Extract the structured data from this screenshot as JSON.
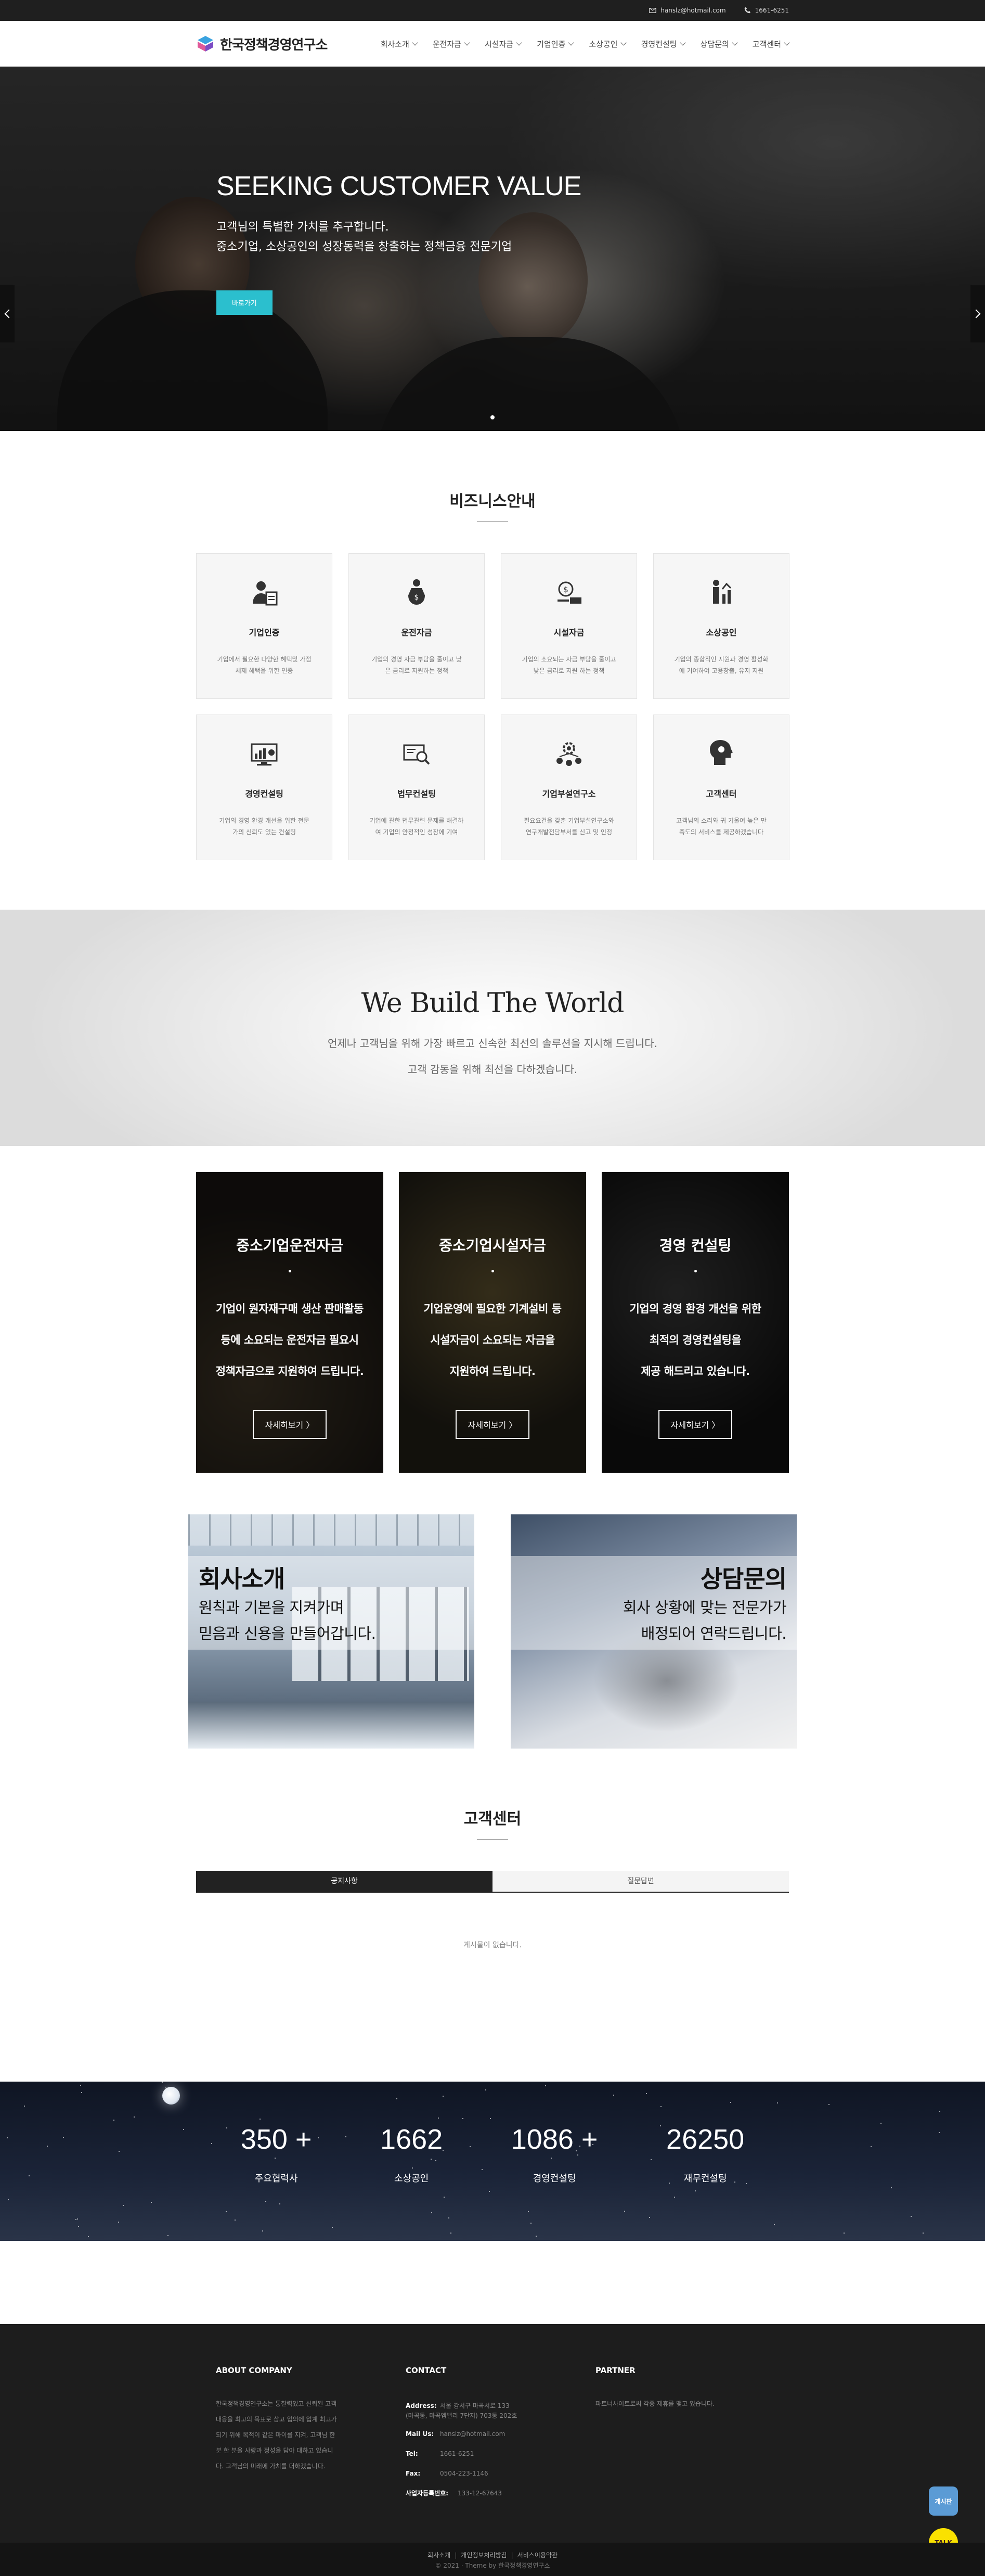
{
  "topbar": {
    "email": "hanslz@hotmail.com",
    "phone": "1661-6251"
  },
  "logo": {
    "text": "한국정책경영연구소"
  },
  "nav": [
    {
      "label": "회사소개"
    },
    {
      "label": "운전자금"
    },
    {
      "label": "시설자금"
    },
    {
      "label": "기업인증"
    },
    {
      "label": "소상공인"
    },
    {
      "label": "경영컨설팅"
    },
    {
      "label": "상담문의"
    },
    {
      "label": "고객센터"
    }
  ],
  "hero": {
    "title": "SEEKING CUSTOMER VALUE",
    "line1": "고객님의 특별한 가치를 추구합니다.",
    "line2": "중소기업, 소상공인의 성장동력을 창출하는 정책금융 전문기업",
    "button": "바로가기"
  },
  "business": {
    "title": "비즈니스안내",
    "cards": [
      {
        "title": "기업인증",
        "desc1": "기업에서 필요한 다양한 혜택및 가점",
        "desc2": "세제 혜택을 위한 인증",
        "icon": "person-certificate-icon"
      },
      {
        "title": "운전자금",
        "desc1": "기업의 경영 자금 부담을 줄이고 낮",
        "desc2": "은 금리로 지원하는 정책",
        "icon": "money-bag-icon"
      },
      {
        "title": "시설자금",
        "desc1": "기업의 소요되는 자금 부담을 줄이고",
        "desc2": "낮은 금리로 지원 하는 정책",
        "icon": "coin-hand-icon"
      },
      {
        "title": "소상공인",
        "desc1": "기업의 종합적인 지원과 경영 활성화",
        "desc2": "에 기여하여 고용창출, 유지 지원",
        "icon": "people-growth-icon"
      },
      {
        "title": "경영컨설팅",
        "desc1": "기업의 경영 환경 개선을 위한 전문",
        "desc2": "가의 신뢰도 있는 컨설팅",
        "icon": "monitor-chart-icon"
      },
      {
        "title": "법무컨설팅",
        "desc1": "기업에 관한 법무관련 문제를 해결하",
        "desc2": "여 기업의 안정적인 성장에 기여",
        "icon": "document-search-icon"
      },
      {
        "title": "기업부설연구소",
        "desc1": "필요요건을 갖춘 기업부설연구소와",
        "desc2": "연구개발전담부서를 신고 및 인정",
        "icon": "gear-team-icon"
      },
      {
        "title": "고객센터",
        "desc1": "고객님의 소리와 귀 기울여 높은 만",
        "desc2": "족도의 서비스를 제공하겠습니다",
        "icon": "head-support-icon"
      }
    ]
  },
  "banner": {
    "title": "We Build The World",
    "line1": "언제나 고객님을 위해 가장 빠르고 신속한 최선의 솔루션을 지시해 드립니다.",
    "line2": "고객 감동을 위해 최선을 다하겠습니다."
  },
  "services": [
    {
      "title": "중소기업운전자금",
      "lines": [
        "기업이 원자재구매 생산 판매활동",
        "등에 소요되는 운전자금 필요시",
        "정책자금으로 지원하여 드립니다."
      ],
      "button": "자세히보기 〉"
    },
    {
      "title": "중소기업시설자금",
      "lines": [
        "기업운영에 필요한 기계설비 등",
        "시설자금이 소요되는 자금을",
        "지원하여 드립니다."
      ],
      "button": "자세히보기 〉"
    },
    {
      "title": "경영 컨설팅",
      "lines": [
        "기업의 경영 환경 개선을 위한",
        "최적의 경영컨설팅을",
        "제공 해드리고 있습니다."
      ],
      "button": "자세히보기 〉"
    }
  ],
  "intro": {
    "company": {
      "title": "회사소개",
      "line1": "원칙과 기본을 지켜가며",
      "line2": "믿음과 신용을 만들어갑니다."
    },
    "consult": {
      "title": "상담문의",
      "line1": "회사 상황에 맞는 전문가가",
      "line2": "배정되어 연락드립니다."
    }
  },
  "customer_center": {
    "title": "고객센터",
    "tabs": [
      {
        "label": "공지사항"
      },
      {
        "label": "질문답변"
      }
    ],
    "empty": "게시물이 없습니다."
  },
  "stats": [
    {
      "value": "350 +",
      "label": "주요협력사"
    },
    {
      "value": "1662",
      "label": "소상공인"
    },
    {
      "value": "1086 +",
      "label": "경영컨설팅"
    },
    {
      "value": "26250",
      "label": "재무컨설팅"
    }
  ],
  "footer": {
    "about": {
      "title": "ABOUT COMPANY",
      "lines": [
        "한국정책경영연구소는 통찰력있고 신뢰된 고객",
        "대응을 최고의 목표로 삼고 업의에 업계 최고가",
        "되기 위해 목적이 같은 마이를 지켜, 고객님 한",
        "분 한 분을 사랑과 정성을 담아 대하고 있습니",
        "다. 고객님의 미래에 가치를 더하겠습니다."
      ]
    },
    "contact": {
      "title": "CONTACT",
      "address_label": "Address:",
      "address1": "서울 강서구 마곡서로 133",
      "address2": "(마곡동, 마곡엠밸리 7단지) 703동 202호",
      "mail_label": "Mail Us:",
      "mail": "hanslz@hotmail.com",
      "tel_label": "Tel:",
      "tel": "1661-6251",
      "fax_label": "Fax:",
      "fax": "0504-223-1146",
      "biz_label": "사업자등록번호:",
      "biz": "133-12-67643"
    },
    "partner": {
      "title": "PARTNER",
      "text": "파트너사이트로써 각종 제휴를 맺고 있습니다."
    },
    "links": [
      {
        "label": "회사소개"
      },
      {
        "label": "개인정보처리방침"
      },
      {
        "label": "서비스이용약관"
      }
    ],
    "copyright": "© 2021 · Theme by 한국정책경영연구소",
    "quick_board": "게시판",
    "quick_talk": "TALK"
  }
}
